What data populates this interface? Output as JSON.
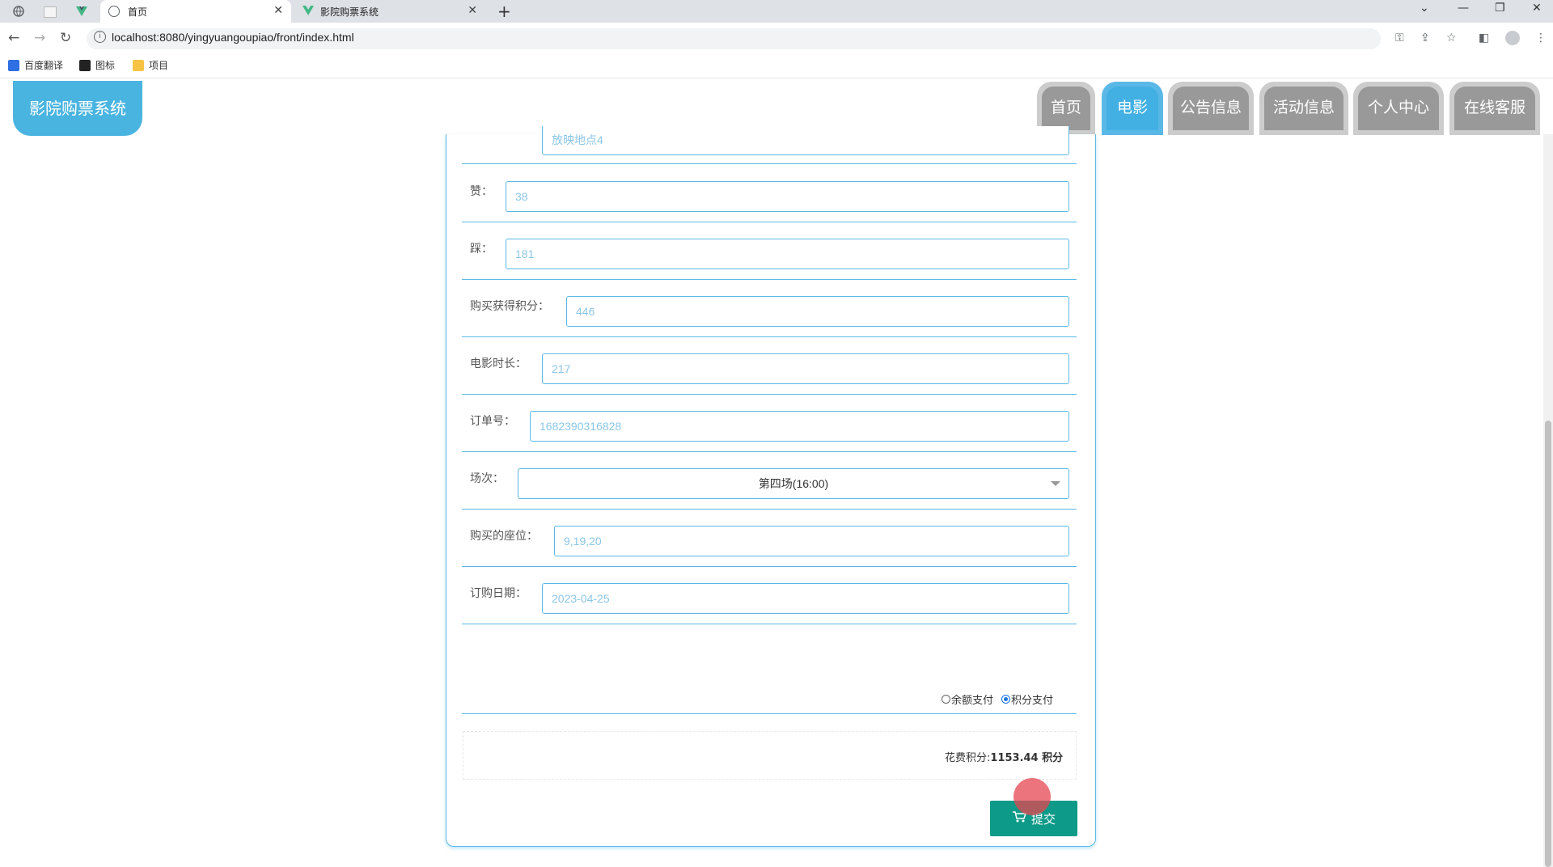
{
  "browser": {
    "tabs": [
      {
        "title": "首页",
        "active": true
      },
      {
        "title": "影院购票系统",
        "active": false
      }
    ],
    "url": "localhost:8080/yingyuangoupiao/front/index.html",
    "bookmarks": [
      "百度翻译",
      "图标",
      "项目"
    ]
  },
  "header": {
    "logo": "影院购票系统",
    "nav": [
      "首页",
      "电影",
      "公告信息",
      "活动信息",
      "个人中心",
      "在线客服"
    ],
    "active_nav": "电影"
  },
  "form": {
    "partial_value": "放映地点4",
    "fields": [
      {
        "label": "赞：",
        "value": "38"
      },
      {
        "label": "踩：",
        "value": "181"
      },
      {
        "label": "购买获得积分：",
        "value": "446"
      },
      {
        "label": "电影时长：",
        "value": "217"
      },
      {
        "label": "订单号：",
        "value": "1682390316828"
      },
      {
        "label": "场次：",
        "value": "第四场(16:00)"
      },
      {
        "label": "购买的座位：",
        "value": "9,19,20"
      },
      {
        "label": "订购日期：",
        "value": "2023-04-25"
      }
    ],
    "payment_options": [
      "余额支付",
      "积分支付"
    ],
    "selected_payment": "积分支付",
    "cost_label": "花费积分:",
    "cost_value": "1153.44 积分",
    "submit_label": "提交"
  },
  "colors": {
    "accent": "#4ab4e0",
    "submit": "#0d9a88"
  }
}
